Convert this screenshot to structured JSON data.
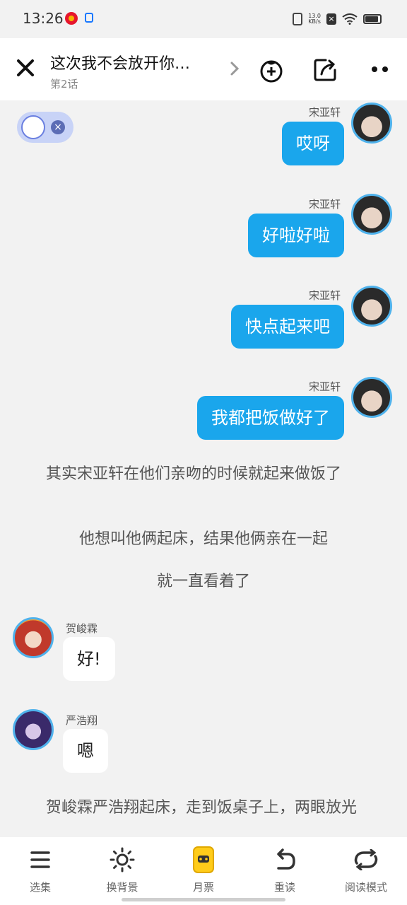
{
  "status_bar": {
    "time": "13:26",
    "net_speed_value": "13.0",
    "net_speed_unit": "KB/s",
    "icons": [
      "weibo-icon",
      "app-icon",
      "vibrate-icon",
      "no-sim-icon",
      "wifi-icon",
      "battery-icon"
    ]
  },
  "header": {
    "title": "这次我不会放开你…",
    "subtitle": "第2话",
    "icons": [
      "close-icon",
      "chevron-right-icon",
      "gift-bag-icon",
      "share-icon",
      "more-icon"
    ]
  },
  "messages": [
    {
      "side": "right",
      "speaker": "宋亚轩",
      "text": "哎呀"
    },
    {
      "side": "right",
      "speaker": "宋亚轩",
      "text": "好啦好啦"
    },
    {
      "side": "right",
      "speaker": "宋亚轩",
      "text": "快点起来吧"
    },
    {
      "side": "right",
      "speaker": "宋亚轩",
      "text": "我都把饭做好了"
    },
    {
      "side": "narration",
      "text": "其实宋亚轩在他们亲吻的时候就起来做饭了"
    },
    {
      "side": "narration",
      "text": "他想叫他俩起床，结果他俩亲在一起"
    },
    {
      "side": "narration",
      "text": "就一直看着了"
    },
    {
      "side": "left",
      "speaker": "贺峻霖",
      "text": "好!"
    },
    {
      "side": "left",
      "speaker": "严浩翔",
      "text": "嗯"
    },
    {
      "side": "narration",
      "text": "贺峻霖严浩翔起床，走到饭桌子上，两眼放光"
    }
  ],
  "bottom_bar": {
    "tabs": [
      {
        "label": "选集",
        "icon": "list-icon"
      },
      {
        "label": "换背景",
        "icon": "sun-icon"
      },
      {
        "label": "月票",
        "icon": "ticket-icon"
      },
      {
        "label": "重读",
        "icon": "undo-icon"
      },
      {
        "label": "阅读模式",
        "icon": "repeat-icon"
      }
    ]
  },
  "colors": {
    "bubble_right": "#1aa6ec",
    "bubble_left": "#ffffff",
    "avatar_ring": "#4fb2ec",
    "background": "#f2f2f2"
  }
}
